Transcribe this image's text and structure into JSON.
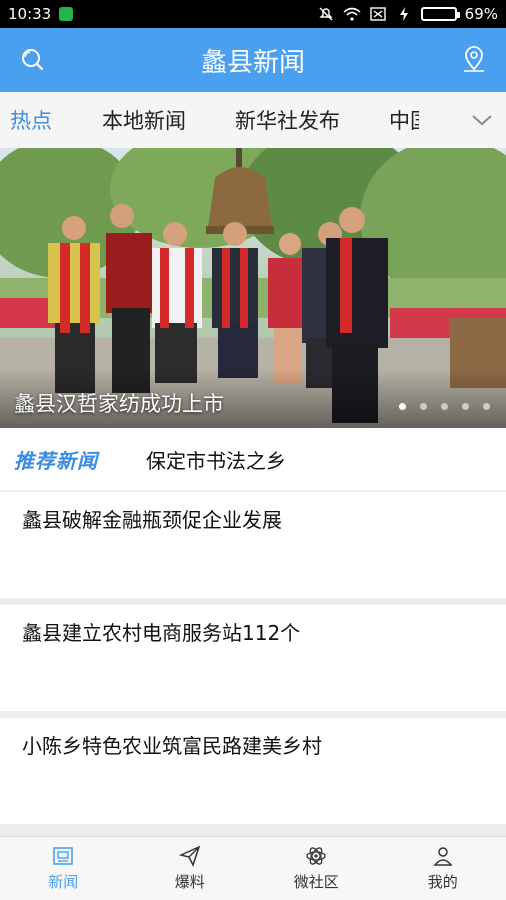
{
  "status_bar": {
    "time": "10:33",
    "battery_percent": "69%",
    "battery_level": 0.69
  },
  "header": {
    "title": "蠡县新闻",
    "left_icon": "search-icon",
    "right_icon": "location-pin-icon"
  },
  "tabs": [
    "热点",
    "本地新闻",
    "新华社发布",
    "中国"
  ],
  "tabs_visible": [
    "热点",
    "本地新闻",
    "新华社发布",
    "中国"
  ],
  "banner": {
    "caption": "蠡县汉哲家纺成功上市",
    "slide_count": 5,
    "active_slide": 0
  },
  "recommend": {
    "label": "推荐新闻",
    "text": "保定市书法之乡"
  },
  "news": [
    {
      "headline": "蠡县破解金融瓶颈促企业发展"
    },
    {
      "headline": "蠡县建立农村电商服务站112个"
    },
    {
      "headline": "小陈乡特色农业筑富民路建美乡村"
    }
  ],
  "bottom_nav": [
    {
      "label": "新闻",
      "icon": "news-icon",
      "active": true
    },
    {
      "label": "爆料",
      "icon": "paper-plane-icon",
      "active": false
    },
    {
      "label": "微社区",
      "icon": "atom-icon",
      "active": false
    },
    {
      "label": "我的",
      "icon": "user-icon",
      "active": false
    }
  ],
  "colors": {
    "accent": "#4aa0ef",
    "active_tab": "#3a8de2"
  }
}
